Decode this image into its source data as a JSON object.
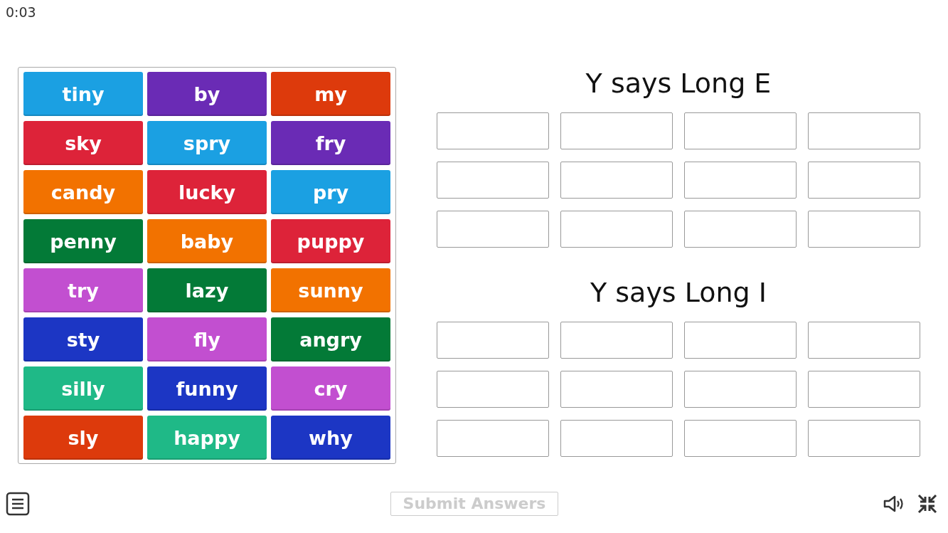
{
  "timer": "0:03",
  "tiles": [
    {
      "label": "tiny",
      "color": "#1ba0e2"
    },
    {
      "label": "by",
      "color": "#6a2bb5"
    },
    {
      "label": "my",
      "color": "#dd3a0c"
    },
    {
      "label": "sky",
      "color": "#dd2339"
    },
    {
      "label": "spry",
      "color": "#1ba0e2"
    },
    {
      "label": "fry",
      "color": "#6a2bb5"
    },
    {
      "label": "candy",
      "color": "#f27200"
    },
    {
      "label": "lucky",
      "color": "#dd2339"
    },
    {
      "label": "pry",
      "color": "#1ba0e2"
    },
    {
      "label": "penny",
      "color": "#037a37"
    },
    {
      "label": "baby",
      "color": "#f27200"
    },
    {
      "label": "puppy",
      "color": "#dd2339"
    },
    {
      "label": "try",
      "color": "#c24fd0"
    },
    {
      "label": "lazy",
      "color": "#037a37"
    },
    {
      "label": "sunny",
      "color": "#f27200"
    },
    {
      "label": "sty",
      "color": "#1c36c4"
    },
    {
      "label": "fly",
      "color": "#c24fd0"
    },
    {
      "label": "angry",
      "color": "#037a37"
    },
    {
      "label": "silly",
      "color": "#1fb987"
    },
    {
      "label": "funny",
      "color": "#1c36c4"
    },
    {
      "label": "cry",
      "color": "#c24fd0"
    },
    {
      "label": "sly",
      "color": "#dd3a0c"
    },
    {
      "label": "happy",
      "color": "#1fb987"
    },
    {
      "label": "why",
      "color": "#1c36c4"
    }
  ],
  "groups": [
    {
      "title": "Y says Long E",
      "slots": [
        {
          "filled": false
        },
        {
          "filled": false
        },
        {
          "filled": false
        },
        {
          "filled": false
        },
        {
          "filled": false
        },
        {
          "filled": false
        },
        {
          "filled": false
        },
        {
          "filled": false
        },
        {
          "filled": false
        },
        {
          "filled": false
        },
        {
          "filled": false
        },
        {
          "filled": false
        }
      ]
    },
    {
      "title": "Y says Long I",
      "slots": [
        {
          "filled": false
        },
        {
          "filled": false
        },
        {
          "filled": false
        },
        {
          "filled": false
        },
        {
          "filled": false
        },
        {
          "filled": false
        },
        {
          "filled": false
        },
        {
          "filled": false
        },
        {
          "filled": false
        },
        {
          "filled": false
        },
        {
          "filled": false
        },
        {
          "filled": false
        }
      ]
    }
  ],
  "submit": {
    "label": "Submit Answers",
    "disabled": true
  }
}
